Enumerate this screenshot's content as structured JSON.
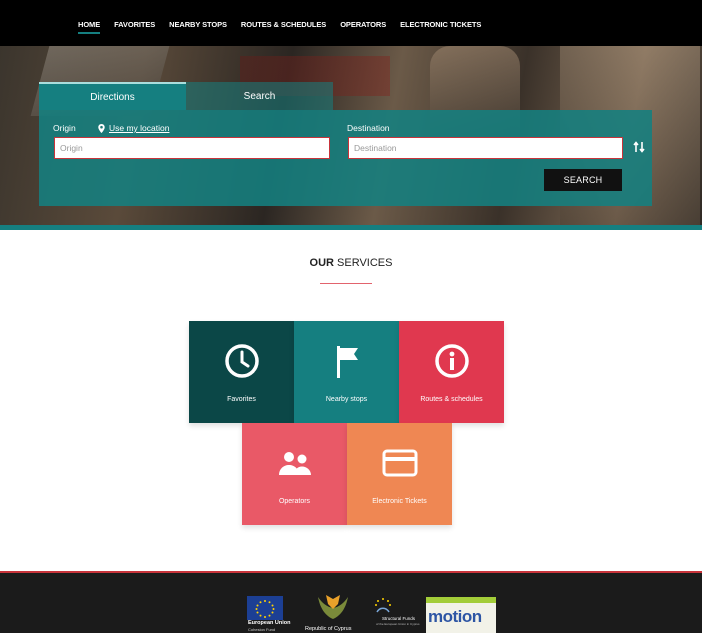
{
  "nav": {
    "items": [
      {
        "label": "HOME",
        "active": true
      },
      {
        "label": "FAVORITES"
      },
      {
        "label": "NEARBY STOPS"
      },
      {
        "label": "ROUTES & SCHEDULES"
      },
      {
        "label": "OPERATORS"
      },
      {
        "label": "ELECTRONIC TICKETS"
      }
    ]
  },
  "search": {
    "tabs": [
      {
        "label": "Directions",
        "active": true
      },
      {
        "label": "Search"
      }
    ],
    "origin_label": "Origin",
    "use_location_label": "Use my location",
    "origin_placeholder": "Origin",
    "destination_label": "Destination",
    "destination_placeholder": "Destination",
    "search_button": "SEARCH",
    "swap_icon": "swap-arrows-icon"
  },
  "services": {
    "title_bold": "OUR",
    "title_rest": " SERVICES",
    "tiles": [
      {
        "label": "Favorites",
        "icon": "clock-icon",
        "color": "#0b4747"
      },
      {
        "label": "Nearby stops",
        "icon": "flag-icon",
        "color": "#157f80"
      },
      {
        "label": "Routes & schedules",
        "icon": "info-icon",
        "color": "#e0384f"
      },
      {
        "label": "Operators",
        "icon": "people-icon",
        "color": "#e95967"
      },
      {
        "label": "Electronic Tickets",
        "icon": "card-icon",
        "color": "#ef8753"
      }
    ]
  },
  "footer": {
    "eu_text": "European Union",
    "eu_sub": "Cohesion Fund",
    "cyprus_text": "Republic of Cyprus",
    "sf_text": "Structural Funds",
    "sf_sub": "of the European Union in Cyprus",
    "motion_text": "motion"
  },
  "colors": {
    "accent": "#157f80",
    "footer_line": "#c8343b"
  }
}
